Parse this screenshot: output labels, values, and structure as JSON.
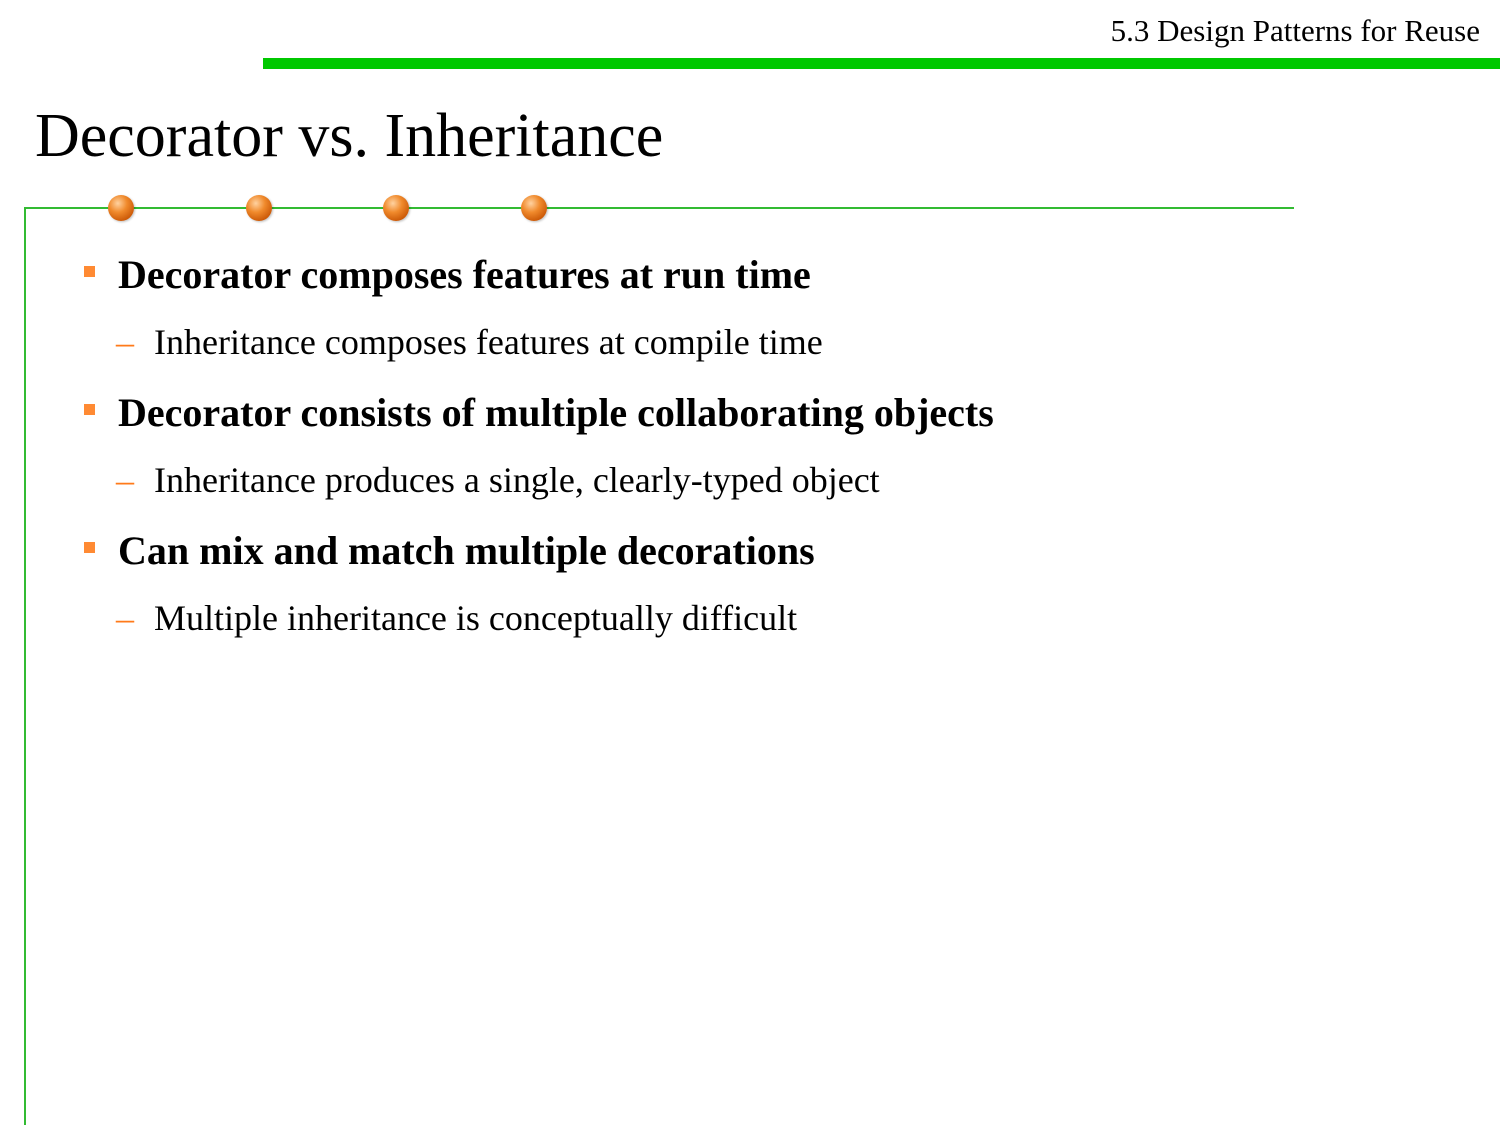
{
  "header": {
    "section": "5.3 Design Patterns for Reuse"
  },
  "slide": {
    "title": "Decorator vs. Inheritance",
    "bullets": [
      {
        "text": "Decorator composes features at run time",
        "sub": "Inheritance composes features at compile time"
      },
      {
        "text": "Decorator consists of multiple collaborating objects",
        "sub": "Inheritance produces a single, clearly-typed object"
      },
      {
        "text": "Can mix and match multiple decorations",
        "sub": "Multiple inheritance is conceptually difficult"
      }
    ],
    "sub_marker": "–"
  },
  "colors": {
    "accent_green": "#00c800",
    "frame_green": "#33bb33",
    "bullet_orange": "#ff8a33",
    "dot_orange": "#f08a2c"
  }
}
